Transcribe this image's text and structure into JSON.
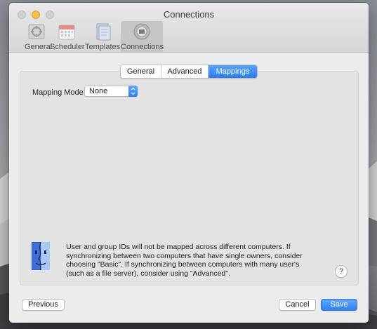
{
  "window": {
    "title": "Connections"
  },
  "toolbar": {
    "items": [
      {
        "label": "General",
        "icon": "general-icon"
      },
      {
        "label": "Scheduler",
        "icon": "calendar-icon"
      },
      {
        "label": "Templates",
        "icon": "templates-icon"
      },
      {
        "label": "Connections",
        "icon": "connections-icon",
        "selected": true
      }
    ]
  },
  "tabs": [
    {
      "label": "General"
    },
    {
      "label": "Advanced"
    },
    {
      "label": "Mappings",
      "active": true
    }
  ],
  "mapping": {
    "label": "Mapping Mode:",
    "value": "None"
  },
  "info": {
    "text": "User and group IDs will not be mapped across different computers. If synchronizing between two computers that have single owners, consider choosing \"Basic\". If synchronizing between computers with many user's (such as a file server), consider using \"Advanced\".",
    "icon": "finder-icon"
  },
  "help": {
    "label": "?"
  },
  "buttons": {
    "previous": "Previous",
    "cancel": "Cancel",
    "save": "Save"
  },
  "colors": {
    "accent": "#2b7cf0",
    "window_bg": "#ececec"
  }
}
